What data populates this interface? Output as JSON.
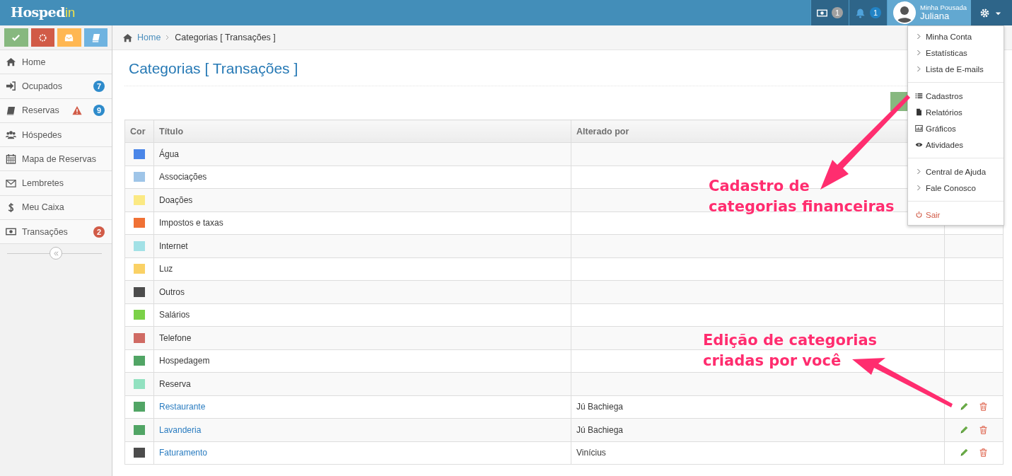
{
  "topbar": {
    "logo": {
      "text": "Hosped",
      "accent": "in"
    },
    "notifications": [
      {
        "count": "1",
        "color": "#a0a0a0"
      },
      {
        "count": "1",
        "color": "#2283c5"
      }
    ],
    "user": {
      "company": "Minha Pousada",
      "name": "Juliana"
    },
    "settings_menu_open": true
  },
  "quick_buttons": [
    {
      "color": "#87b87f"
    },
    {
      "color": "#d15b47"
    },
    {
      "color": "#ffb752"
    },
    {
      "color": "#6fb3e0"
    }
  ],
  "sidebar": {
    "items": [
      {
        "label": "Home"
      },
      {
        "label": "Ocupados",
        "badge": "7",
        "color": "#2e8bcb"
      },
      {
        "label": "Reservas",
        "warning": true,
        "badge": "9",
        "color": "#2e8bcb"
      },
      {
        "label": "Hóspedes"
      },
      {
        "label": "Mapa de Reservas"
      },
      {
        "label": "Lembretes"
      },
      {
        "label": "Meu Caixa"
      },
      {
        "label": "Transações",
        "badge": "2",
        "color": "#d15b47"
      }
    ]
  },
  "breadcrumb": [
    {
      "label": "Home",
      "kind": "link"
    },
    {
      "label": "Categorias [ Transações ]",
      "kind": "current"
    }
  ],
  "page_title": "Categorias [ Transações ]",
  "table": {
    "columns": [
      "Cor",
      "Título",
      "Alterado por"
    ],
    "rows": [
      {
        "color": "#4a86e8",
        "title": "Água",
        "author": "",
        "kind": "system"
      },
      {
        "color": "#9fc5e8",
        "title": "Associações",
        "author": "",
        "kind": "system"
      },
      {
        "color": "#fbe983",
        "title": "Doações",
        "author": "",
        "kind": "system"
      },
      {
        "color": "#f07135",
        "title": "Impostos e taxas",
        "author": "",
        "kind": "system"
      },
      {
        "color": "#a2e1e6",
        "title": "Internet",
        "author": "",
        "kind": "system"
      },
      {
        "color": "#fad165",
        "title": "Luz",
        "author": "",
        "kind": "system"
      },
      {
        "color": "#4c4c4c",
        "title": "Outros",
        "author": "",
        "kind": "system"
      },
      {
        "color": "#7bd148",
        "title": "Salários",
        "author": "",
        "kind": "system"
      },
      {
        "color": "#d06b64",
        "title": "Telefone",
        "author": "",
        "kind": "system"
      },
      {
        "color": "#51a565",
        "title": "Hospedagem",
        "author": "",
        "kind": "system"
      },
      {
        "color": "#92e1c0",
        "title": "Reserva",
        "author": "",
        "kind": "system"
      },
      {
        "color": "#51a565",
        "title": "Restaurante",
        "author": "Jú Bachiega",
        "kind": "custom"
      },
      {
        "color": "#51a565",
        "title": "Lavanderia",
        "author": "Jú Bachiega",
        "kind": "custom"
      },
      {
        "color": "#4c4c4c",
        "title": "Faturamento",
        "author": "Vinícius",
        "kind": "custom"
      }
    ]
  },
  "settings_menu": {
    "groups": [
      [
        {
          "label": "Minha Conta",
          "kind": "link"
        },
        {
          "label": "Estatísticas",
          "kind": "link"
        },
        {
          "label": "Lista de E-mails",
          "kind": "link"
        }
      ],
      [
        {
          "label": "Cadastros",
          "kind": "list"
        },
        {
          "label": "Relatórios",
          "kind": "file"
        },
        {
          "label": "Gráficos",
          "kind": "chart"
        },
        {
          "label": "Atividades",
          "kind": "eye"
        }
      ],
      [
        {
          "label": "Central de Ajuda",
          "kind": "link"
        },
        {
          "label": "Fale Conosco",
          "kind": "link"
        }
      ],
      [
        {
          "label": "Sair",
          "kind": "logout"
        }
      ]
    ]
  },
  "annotations": [
    {
      "lines": [
        "Cadastro de",
        "categorias financeiras"
      ]
    },
    {
      "lines": [
        "Edição de categorias",
        "criadas por você"
      ]
    }
  ]
}
